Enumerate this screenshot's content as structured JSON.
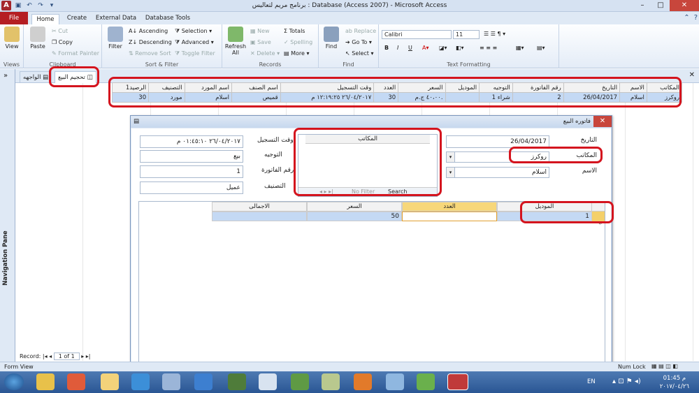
{
  "window": {
    "title": "برنامج مريم لتعاليس : Database (Access 2007) - Microsoft Access",
    "controls": {
      "minimize": "–",
      "maximize": "□",
      "close": "✕"
    }
  },
  "ribbon_tabs": [
    "File",
    "Home",
    "Create",
    "External Data",
    "Database Tools"
  ],
  "ribbon": {
    "views": {
      "view_label": "View",
      "group": "Views"
    },
    "clipboard": {
      "paste": "Paste",
      "cut": "Cut",
      "copy": "Copy",
      "format_painter": "Format Painter",
      "group": "Clipboard"
    },
    "sort_filter": {
      "filter": "Filter",
      "ascending": "Ascending",
      "descending": "Descending",
      "remove_sort": "Remove Sort",
      "selection": "Selection",
      "advanced": "Advanced",
      "toggle_filter": "Toggle Filter",
      "group": "Sort & Filter"
    },
    "records": {
      "refresh": "Refresh",
      "refresh_all": "All",
      "new": "New",
      "save": "Save",
      "delete": "Delete",
      "totals": "Totals",
      "spelling": "Spelling",
      "more": "More",
      "group": "Records"
    },
    "find": {
      "find": "Find",
      "replace": "Replace",
      "goto": "Go To",
      "select": "Select",
      "group": "Find"
    },
    "text_formatting": {
      "font": "Calibri",
      "size": "11",
      "group": "Text Formatting"
    }
  },
  "nav_pane": {
    "label": "Navigation Pane",
    "toggle": "»"
  },
  "doc_tabs": [
    {
      "label": "تحجيم البيع",
      "active": true
    },
    {
      "label": "الواجهه",
      "active": false
    }
  ],
  "datasheet": {
    "headers": [
      "المكاتب",
      "الاسم",
      "التاريخ",
      "رقم الفاتورة",
      "التوجيه",
      "الموديل",
      "السعر",
      "العدد",
      "وقت التسجيل",
      "اسم الصنف",
      "اسم المورد",
      "التصنيف",
      "الرصيد1"
    ],
    "row": [
      "روكرز",
      "اسلام",
      "26/04/2017",
      "2",
      "شراء 1",
      "",
      "٤٠،٠٠ ج.م.",
      "30",
      "٢٦/٠٤/٢٠١٧ ١٢:١٩:٢٥ م",
      "قميص",
      "اسلام",
      "مورد",
      "30"
    ]
  },
  "dialog": {
    "title": "فاتوره البيع",
    "fields": {
      "date_label": "التاريخ",
      "date_value": "26/04/2017",
      "office_label": "المكاتب",
      "office_value": "روكرز",
      "name_label": "الاسم",
      "name_value": "اسلام",
      "time_label": "وقت التسجيل",
      "time_value": "٢٦/٠٤/٢٠١٧ ٠١:٤٥:١٠ م",
      "direction_label": "التوجيه",
      "direction_value": "بيع",
      "invoice_label": "رقم الفاتورة",
      "invoice_value": "1",
      "category_label": "التصنيف",
      "category_value": "عميل"
    },
    "subgrid": {
      "header": "المكاتب",
      "no_filter": "No Filter",
      "search": "Search"
    },
    "lines": {
      "headers": [
        "الموديل",
        "العدد",
        "السعر",
        "الاجمالى"
      ],
      "row": [
        "1",
        "",
        "50",
        ""
      ]
    }
  },
  "record_nav": {
    "label": "Record:",
    "position": "1 of 1"
  },
  "status": {
    "left": "Form View",
    "num_lock": "Num Lock"
  },
  "taskbar": {
    "lang": "EN",
    "time": "01:45 م",
    "date": "٢٠١٧/٠٤/٢٦"
  }
}
